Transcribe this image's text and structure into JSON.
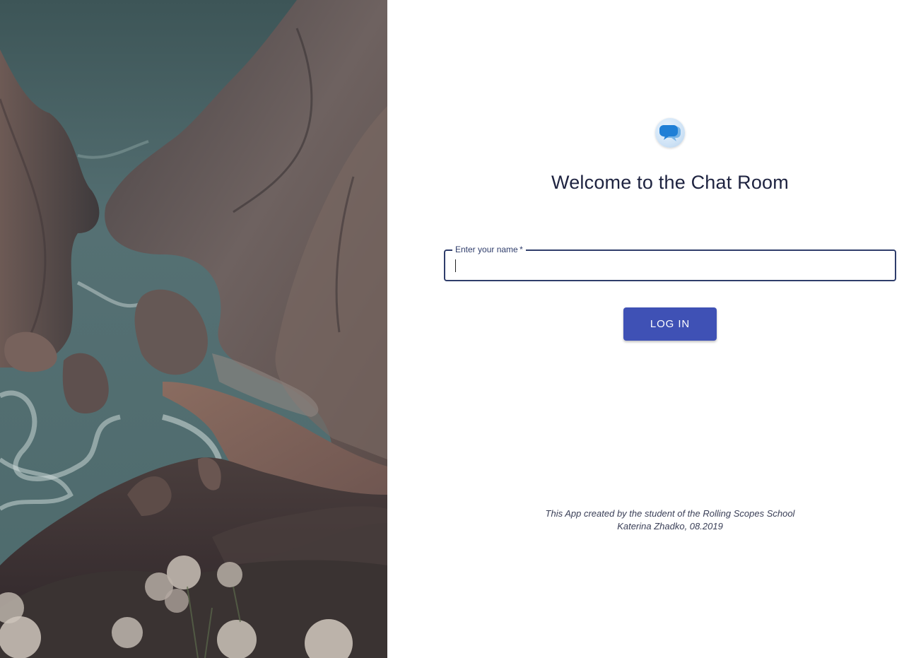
{
  "hero_image": {
    "description_icon": "coastal-cliff-photo"
  },
  "login": {
    "logo_icon": "chat-bubbles-icon",
    "title": "Welcome to the Chat Room",
    "name_field": {
      "label": "Enter your name",
      "required_marker": "*",
      "value": ""
    },
    "login_button_label": "LOG IN"
  },
  "footer": {
    "line1": "This App created by the student of the Rolling Scopes School",
    "line2": "Katerina Zhadko, 08.2019"
  },
  "colors": {
    "accent": "#3f51b5",
    "title_text": "#1e2340",
    "field_border": "#2f3d6b"
  }
}
